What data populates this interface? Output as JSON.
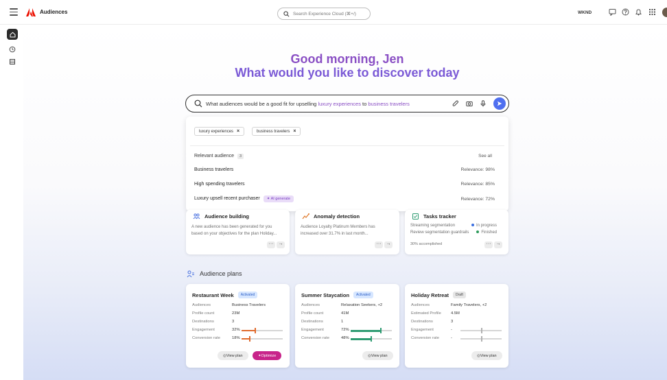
{
  "app": {
    "title": "Audiences",
    "org": "WKND"
  },
  "search": {
    "placeholder": "Search Experience Cloud (⌘+/)"
  },
  "greeting": {
    "line1": "Good morning, Jen",
    "line2": "What would you like to discover today"
  },
  "prompt": {
    "parts": [
      "What audiences would be a good fit for upselling ",
      "luxury experiences",
      " to ",
      "business travelers"
    ]
  },
  "chips": [
    "luxury experiences",
    "business travelers"
  ],
  "relevant": {
    "heading": "Relevant audience",
    "count": "3",
    "see_all": "See all",
    "items": [
      {
        "name": "Business travelers",
        "relevance": "Relevance: 98%"
      },
      {
        "name": "High spending travelers",
        "relevance": "Relevance: 85%"
      },
      {
        "name": "Luxury upsell recent purchaser",
        "badge": "AI generate",
        "relevance": "Relevance: 72%"
      }
    ]
  },
  "cards": {
    "building": {
      "title": "Audience building",
      "body1": "A new audience has been generated for you",
      "body2": "based on your objectives for the plan Holiday..."
    },
    "anomaly": {
      "title": "Anomaly detection",
      "body1": "Audience Loyalty Platinum Members has",
      "body2": "increased over 31.7% in last month..."
    },
    "tasks": {
      "title": "Tasks tracker",
      "rows": [
        {
          "label": "Streaming segmentation",
          "status": "In progress",
          "color": "#3b6fe0"
        },
        {
          "label": "Review segmentation guardrails",
          "status": "Finished",
          "color": "#2e9b5b"
        }
      ],
      "progress": "30% accomplished",
      "progress_value": 0.3
    },
    "more": "···",
    "arrow": "→"
  },
  "plans_heading": "Audience plans",
  "plans": [
    {
      "title": "Restaurant Week",
      "status": "Activated",
      "rows": [
        {
          "k": "Audiences",
          "v": "Business Travelers"
        },
        {
          "k": "Profile count",
          "v": "23M"
        },
        {
          "k": "Destinations",
          "v": "3"
        },
        {
          "k": "Engagement",
          "v": "32%"
        },
        {
          "k": "Conversion rate",
          "v": "18%"
        }
      ],
      "view": "View plan",
      "optimize": "Optimize"
    },
    {
      "title": "Summer Staycation",
      "status": "Activated",
      "rows": [
        {
          "k": "Audiences",
          "v": "Relaxation Seekers, +2"
        },
        {
          "k": "Profile count",
          "v": "41M"
        },
        {
          "k": "Destinations",
          "v": "1"
        },
        {
          "k": "Engagement",
          "v": "72%"
        },
        {
          "k": "Conversion rate",
          "v": "48%"
        }
      ],
      "view": "View plan"
    },
    {
      "title": "Holiday Retreat",
      "status": "Draft",
      "rows": [
        {
          "k": "Audiences",
          "v": "Family Travelers, +2"
        },
        {
          "k": "Estimated Profile",
          "v": "4.5M"
        },
        {
          "k": "Destinations",
          "v": "3"
        },
        {
          "k": "Engagement",
          "v": "-"
        },
        {
          "k": "Conversion rate",
          "v": "-"
        }
      ],
      "view": "View plan"
    }
  ],
  "metrics": {
    "engagement": [
      0.32,
      0.72,
      null
    ],
    "conversion": [
      0.18,
      0.48,
      null
    ],
    "colors": {
      "orange": "#e06a2c",
      "green": "#2e9b72",
      "gray": "#b0b0b0"
    }
  },
  "colors": {
    "accent_purple": "#8a4fc4",
    "send_blue": "#4f6ff0",
    "optimize": "#c8248a"
  },
  "icons": [
    "menu-icon",
    "adobe-logo",
    "search-icon",
    "feedback-icon",
    "help-icon",
    "bell-icon",
    "apps-icon",
    "home-icon",
    "clock-icon",
    "list-icon",
    "paperclip-icon",
    "camera-icon",
    "microphone-icon",
    "send-icon"
  ]
}
